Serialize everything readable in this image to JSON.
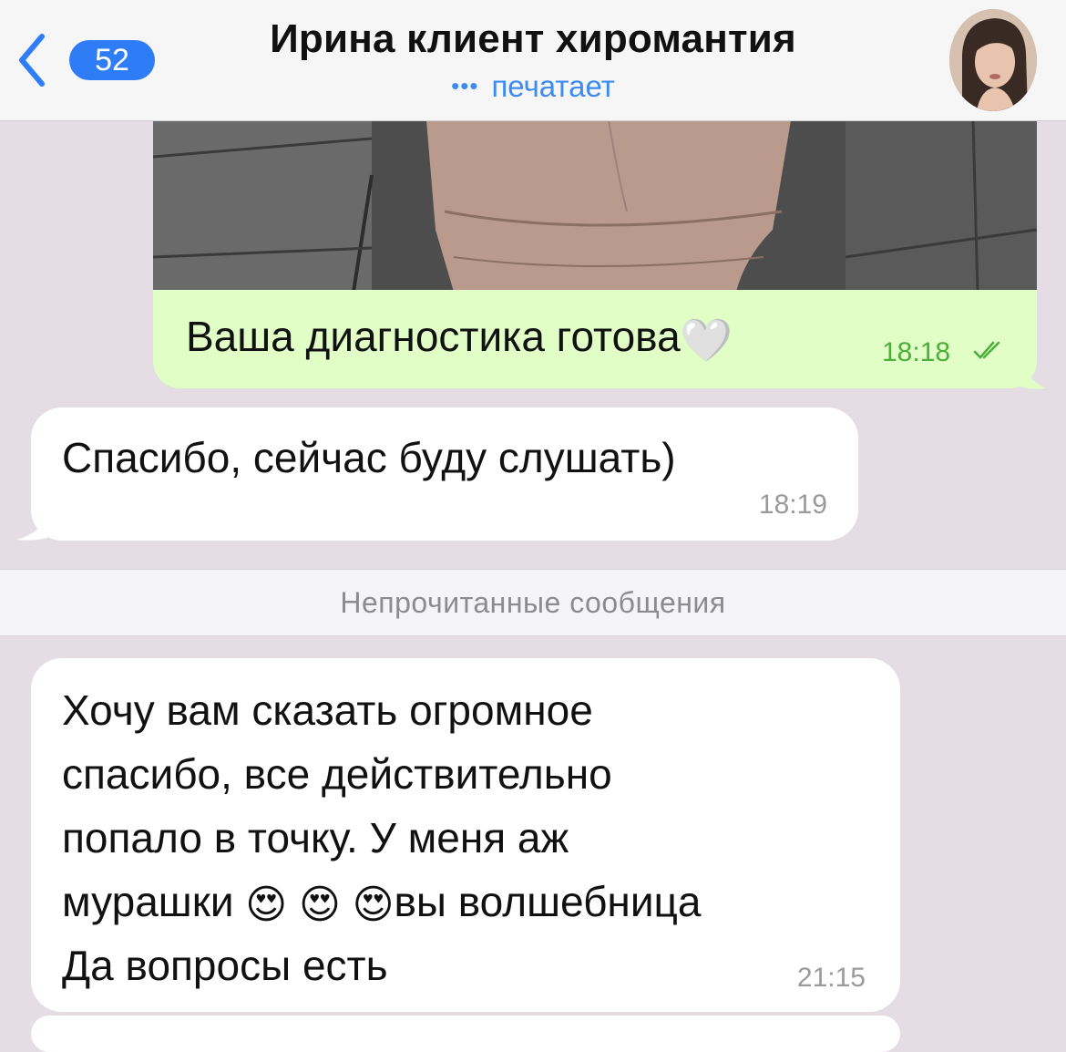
{
  "header": {
    "back_badge": "52",
    "title": "Ирина клиент хиромантия",
    "status": "печатает",
    "status_dots": "•••"
  },
  "messages": {
    "outgoing": {
      "text": "Ваша диагностика готова",
      "emoji": "🤍",
      "time": "18:18"
    },
    "incoming_1": {
      "text": "Спасибо, сейчас буду слушать)",
      "time": "18:19"
    },
    "unread_divider": "Непрочитанные сообщения",
    "incoming_2": {
      "line1": "Хочу вам сказать огромное",
      "line2": "спасибо, все действительно",
      "line3": "попало в точку. У меня аж",
      "line4a": "мурашки ",
      "emoji": "😍",
      "line4b": "вы волшебница",
      "line5": "Да вопросы есть",
      "time": "21:15"
    }
  },
  "colors": {
    "accent": "#2f7df6",
    "outgoing_bubble": "#e1fec6",
    "outgoing_time": "#4caf3a",
    "background": "#e4dde3"
  }
}
